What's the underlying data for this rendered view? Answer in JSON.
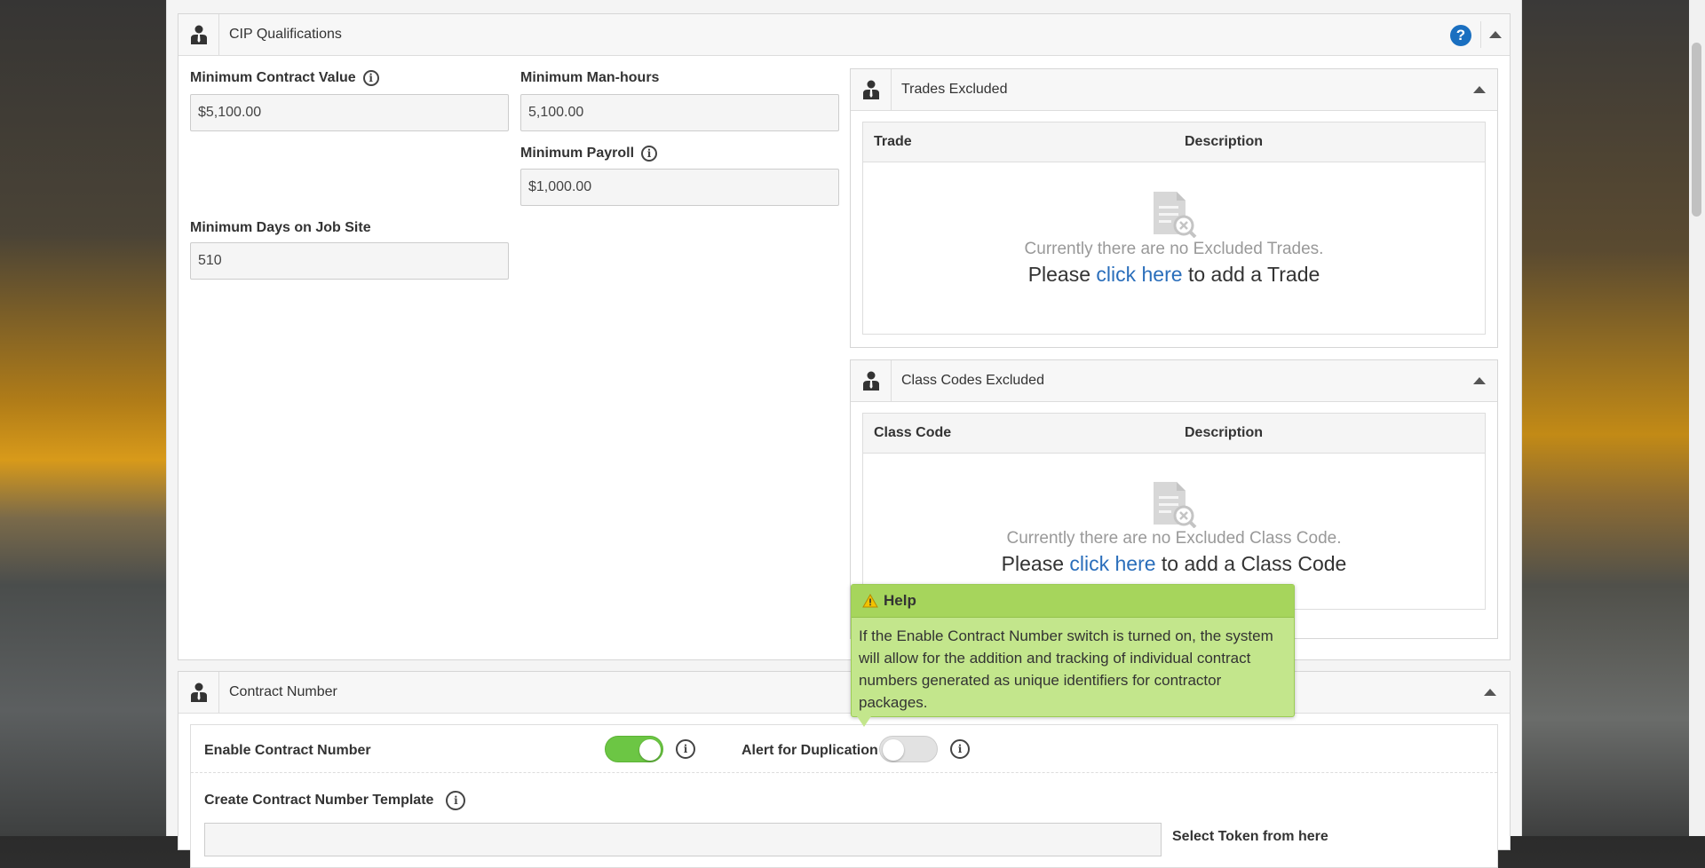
{
  "cip": {
    "title": "CIP Qualifications",
    "fields": {
      "min_contract_value": {
        "label": "Minimum Contract Value",
        "value": "$5,100.00"
      },
      "min_man_hours": {
        "label": "Minimum Man-hours",
        "value": "5,100.00"
      },
      "min_payroll": {
        "label": "Minimum Payroll",
        "value": "$1,000.00"
      },
      "min_days": {
        "label": "Minimum Days on Job Site",
        "value": "510"
      }
    },
    "trades": {
      "title": "Trades Excluded",
      "col1": "Trade",
      "col2": "Description",
      "empty": "Currently there are no Excluded Trades.",
      "cta_pre": "Please",
      "cta_link": "click here",
      "cta_post": "to add a Trade"
    },
    "class_codes": {
      "title": "Class Codes Excluded",
      "col1": "Class Code",
      "col2": "Description",
      "empty": "Currently there are no Excluded Class Code.",
      "cta_pre": "Please",
      "cta_link": "click here",
      "cta_post": "to add a Class Code"
    }
  },
  "contract": {
    "title": "Contract Number",
    "enable_label": "Enable Contract Number",
    "enable_on": true,
    "alert_label": "Alert for Duplication",
    "alert_on": false,
    "template_label": "Create Contract Number Template",
    "select_token_label": "Select Token from here"
  },
  "help": {
    "title": "Help",
    "text": "If the Enable Contract Number switch is turned on, the system will allow for the addition and tracking of individual contract numbers generated as unique identifiers for contractor packages."
  },
  "colors": {
    "toggle_on": "#6cc644",
    "help_bg": "#c3e68c",
    "link": "#2a6ebb"
  }
}
